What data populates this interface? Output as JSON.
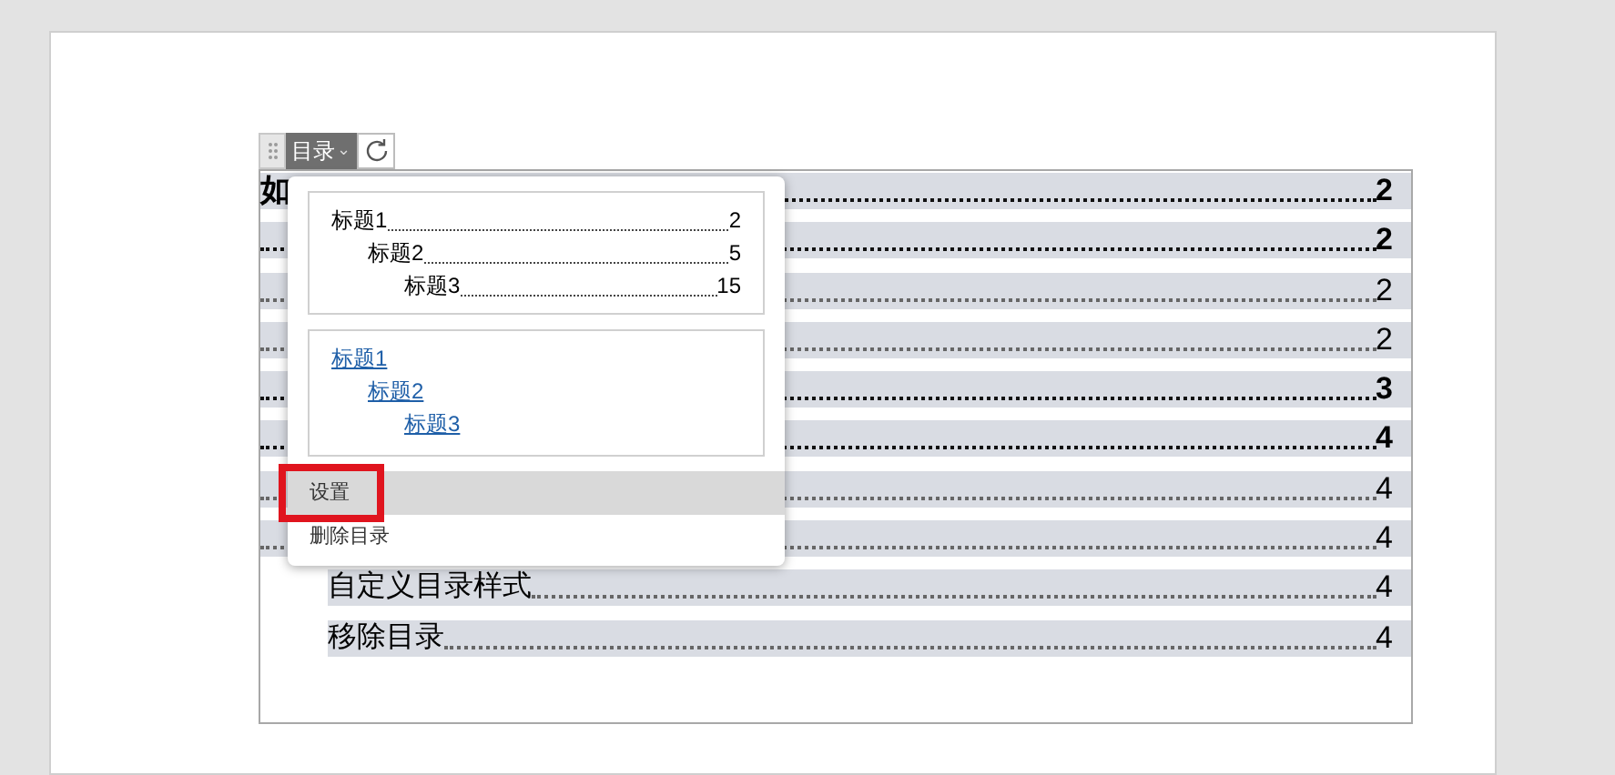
{
  "toolbar": {
    "label": "目录",
    "caret": "⌄"
  },
  "toc_rows": [
    {
      "text": "如",
      "bold": true,
      "indent": false,
      "page": "2"
    },
    {
      "bold": true,
      "page": "2"
    },
    {
      "bold": false,
      "page": "2"
    },
    {
      "bold": false,
      "page": "2"
    },
    {
      "bold": true,
      "page": "3"
    },
    {
      "bold": true,
      "page": "4"
    },
    {
      "bold": false,
      "page": "4"
    },
    {
      "bold": false,
      "page": "4"
    },
    {
      "text": "自定义目录样式",
      "bold": false,
      "indent": true,
      "page": "4"
    },
    {
      "text": "移除目录",
      "bold": false,
      "indent": true,
      "page": "4"
    }
  ],
  "menu": {
    "styles": [
      {
        "kind": "dotted",
        "entries": [
          {
            "text": "标题1",
            "page": "2",
            "children": [
              {
                "text": "标题2",
                "page": "5",
                "children": [
                  {
                    "text": "标题3",
                    "page": "15"
                  }
                ]
              }
            ]
          }
        ]
      },
      {
        "kind": "links",
        "entries": [
          {
            "text": "标题1",
            "children": [
              {
                "text": "标题2",
                "children": [
                  {
                    "text": "标题3"
                  }
                ]
              }
            ]
          }
        ]
      }
    ],
    "items": [
      {
        "label": "设置",
        "highlighted": true,
        "outlined": true
      },
      {
        "label": "删除目录",
        "highlighted": false,
        "outlined": false
      }
    ]
  }
}
